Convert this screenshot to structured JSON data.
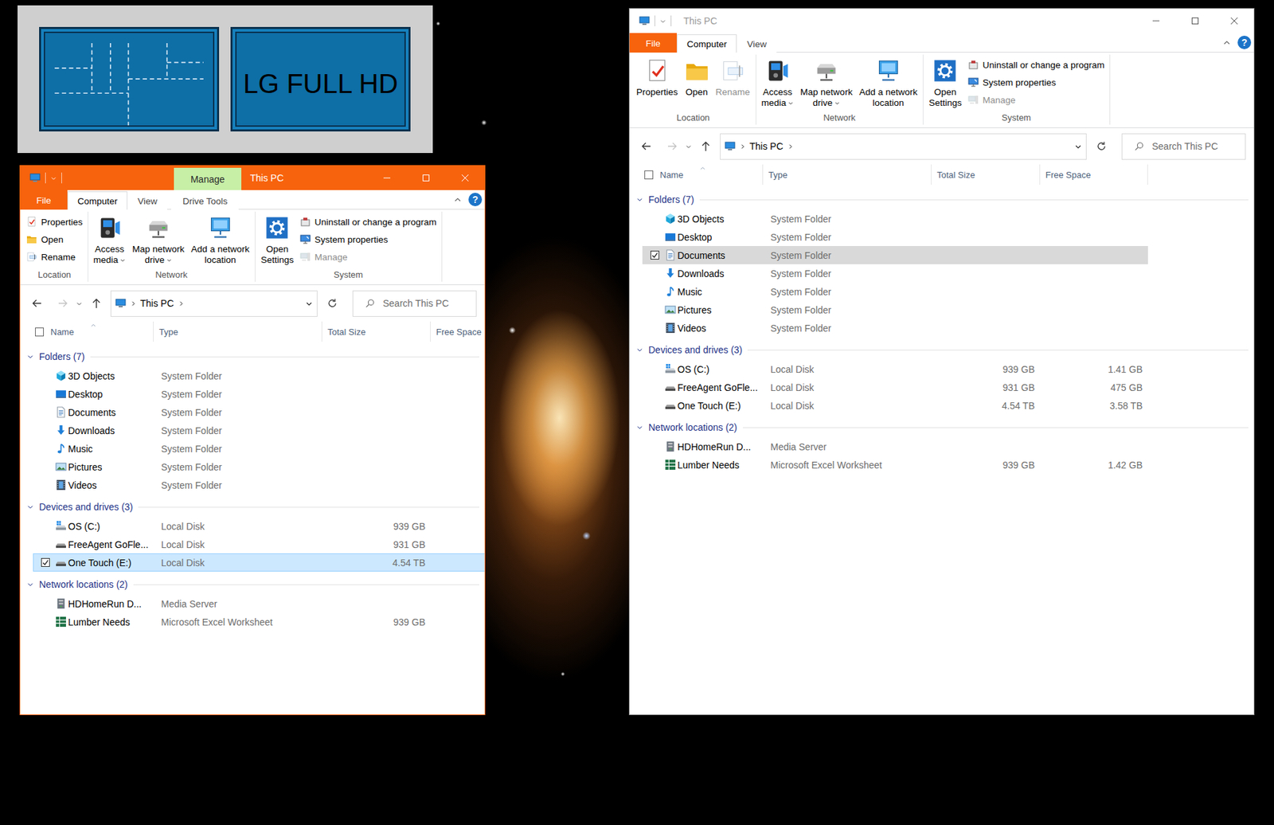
{
  "display_identify": {
    "monitors": [
      {
        "kind": "zones"
      },
      {
        "kind": "label",
        "label": "LG FULL HD"
      }
    ]
  },
  "windows": [
    {
      "title": "This PC",
      "active": true,
      "contextual_tab": "Manage",
      "help": "?",
      "ribbon_tabs": [
        {
          "label": "File",
          "selected": false,
          "kind": "file"
        },
        {
          "label": "Computer",
          "selected": true,
          "kind": "tab"
        },
        {
          "label": "View",
          "selected": false,
          "kind": "tab"
        },
        {
          "label": "Drive Tools",
          "selected": false,
          "kind": "contextual"
        }
      ],
      "ribbon_groups": [
        {
          "label": "Location",
          "buttons": [
            {
              "lines": [
                "Properties"
              ],
              "kind": "small",
              "dropdown": false,
              "disabled": false
            },
            {
              "lines": [
                "Open"
              ],
              "kind": "small",
              "dropdown": false,
              "disabled": false
            },
            {
              "lines": [
                "Rename"
              ],
              "kind": "small",
              "dropdown": false,
              "disabled": false
            }
          ]
        },
        {
          "label": "Network",
          "buttons": [
            {
              "lines": [
                "Access",
                "media"
              ],
              "kind": "large",
              "dropdown": true,
              "disabled": false
            },
            {
              "lines": [
                "Map network",
                "drive"
              ],
              "kind": "large",
              "dropdown": true,
              "disabled": false
            },
            {
              "lines": [
                "Add a network",
                "location"
              ],
              "kind": "large",
              "dropdown": false,
              "disabled": false
            }
          ]
        },
        {
          "label": "System",
          "buttons": [
            {
              "lines": [
                "Open",
                "Settings"
              ],
              "kind": "large",
              "dropdown": false,
              "disabled": false
            },
            {
              "lines": [
                "Uninstall or change a program"
              ],
              "kind": "small",
              "dropdown": false,
              "disabled": false
            },
            {
              "lines": [
                "System properties"
              ],
              "kind": "small",
              "dropdown": false,
              "disabled": false
            },
            {
              "lines": [
                "Manage"
              ],
              "kind": "small",
              "dropdown": false,
              "disabled": true
            }
          ]
        }
      ],
      "navigation": {
        "back_disabled": false,
        "forward_disabled": true
      },
      "address": {
        "location": "This PC"
      },
      "search": {
        "placeholder": "Search This PC"
      },
      "columns": [
        {
          "label": "Name",
          "sorted": true
        },
        {
          "label": "Type",
          "sorted": false
        },
        {
          "label": "Total Size",
          "sorted": false
        },
        {
          "label": "Free Space",
          "sorted": false
        }
      ],
      "sections": [
        {
          "label": "Folders (7)",
          "expanded": true,
          "rows": [
            {
              "name": "3D Objects",
              "type": "System Folder",
              "selected": false,
              "checked": false
            },
            {
              "name": "Desktop",
              "type": "System Folder",
              "selected": false,
              "checked": false
            },
            {
              "name": "Documents",
              "type": "System Folder",
              "selected": false,
              "checked": false
            },
            {
              "name": "Downloads",
              "type": "System Folder",
              "selected": false,
              "checked": false
            },
            {
              "name": "Music",
              "type": "System Folder",
              "selected": false,
              "checked": false
            },
            {
              "name": "Pictures",
              "type": "System Folder",
              "selected": false,
              "checked": false
            },
            {
              "name": "Videos",
              "type": "System Folder",
              "selected": false,
              "checked": false
            }
          ]
        },
        {
          "label": "Devices and drives (3)",
          "expanded": true,
          "rows": [
            {
              "name": "OS (C:)",
              "type": "Local Disk",
              "total": "939 GB",
              "selected": false,
              "checked": false
            },
            {
              "name": "FreeAgent GoFle...",
              "type": "Local Disk",
              "total": "931 GB",
              "selected": false,
              "checked": false
            },
            {
              "name": "One Touch (E:)",
              "type": "Local Disk",
              "total": "4.54 TB",
              "selected": true,
              "checked": true
            }
          ]
        },
        {
          "label": "Network locations (2)",
          "expanded": true,
          "rows": [
            {
              "name": "HDHomeRun D...",
              "type": "Media Server",
              "selected": false,
              "checked": false
            },
            {
              "name": "Lumber Needs",
              "type": "Microsoft Excel Worksheet",
              "total": "939 GB",
              "selected": false,
              "checked": false
            }
          ]
        }
      ]
    },
    {
      "title": "This PC",
      "active": false,
      "help": "?",
      "ribbon_tabs": [
        {
          "label": "File",
          "selected": false,
          "kind": "file"
        },
        {
          "label": "Computer",
          "selected": true,
          "kind": "tab"
        },
        {
          "label": "View",
          "selected": false,
          "kind": "tab"
        }
      ],
      "ribbon_groups": [
        {
          "label": "Location",
          "buttons": [
            {
              "lines": [
                "Properties"
              ],
              "kind": "large",
              "dropdown": false,
              "disabled": false
            },
            {
              "lines": [
                "Open"
              ],
              "kind": "large",
              "dropdown": false,
              "disabled": false
            },
            {
              "lines": [
                "Rename"
              ],
              "kind": "large",
              "dropdown": false,
              "disabled": true
            }
          ]
        },
        {
          "label": "Network",
          "buttons": [
            {
              "lines": [
                "Access",
                "media"
              ],
              "kind": "large",
              "dropdown": true,
              "disabled": false
            },
            {
              "lines": [
                "Map network",
                "drive"
              ],
              "kind": "large",
              "dropdown": true,
              "disabled": false
            },
            {
              "lines": [
                "Add a network",
                "location"
              ],
              "kind": "large",
              "dropdown": false,
              "disabled": false
            }
          ]
        },
        {
          "label": "System",
          "buttons": [
            {
              "lines": [
                "Open",
                "Settings"
              ],
              "kind": "large",
              "dropdown": false,
              "disabled": false
            },
            {
              "lines": [
                "Uninstall or change a program"
              ],
              "kind": "small",
              "dropdown": false,
              "disabled": false
            },
            {
              "lines": [
                "System properties"
              ],
              "kind": "small",
              "dropdown": false,
              "disabled": false
            },
            {
              "lines": [
                "Manage"
              ],
              "kind": "small",
              "dropdown": false,
              "disabled": true
            }
          ]
        }
      ],
      "navigation": {
        "back_disabled": false,
        "forward_disabled": true
      },
      "address": {
        "location": "This PC"
      },
      "search": {
        "placeholder": "Search This PC"
      },
      "columns": [
        {
          "label": "Name",
          "sorted": true
        },
        {
          "label": "Type",
          "sorted": false
        },
        {
          "label": "Total Size",
          "sorted": false
        },
        {
          "label": "Free Space",
          "sorted": false
        }
      ],
      "sections": [
        {
          "label": "Folders (7)",
          "expanded": true,
          "rows": [
            {
              "name": "3D Objects",
              "type": "System Folder",
              "selected": false,
              "checked": false
            },
            {
              "name": "Desktop",
              "type": "System Folder",
              "selected": false,
              "checked": false
            },
            {
              "name": "Documents",
              "type": "System Folder",
              "selected": true,
              "checked": true
            },
            {
              "name": "Downloads",
              "type": "System Folder",
              "selected": false,
              "checked": false
            },
            {
              "name": "Music",
              "type": "System Folder",
              "selected": false,
              "checked": false
            },
            {
              "name": "Pictures",
              "type": "System Folder",
              "selected": false,
              "checked": false
            },
            {
              "name": "Videos",
              "type": "System Folder",
              "selected": false,
              "checked": false
            }
          ]
        },
        {
          "label": "Devices and drives (3)",
          "expanded": true,
          "rows": [
            {
              "name": "OS (C:)",
              "type": "Local Disk",
              "total": "939 GB",
              "free": "1.41 GB",
              "selected": false,
              "checked": false
            },
            {
              "name": "FreeAgent GoFle...",
              "type": "Local Disk",
              "total": "931 GB",
              "free": "475 GB",
              "selected": false,
              "checked": false
            },
            {
              "name": "One Touch (E:)",
              "type": "Local Disk",
              "total": "4.54 TB",
              "free": "3.58 TB",
              "selected": false,
              "checked": false
            }
          ]
        },
        {
          "label": "Network locations (2)",
          "expanded": true,
          "rows": [
            {
              "name": "HDHomeRun D...",
              "type": "Media Server",
              "selected": false,
              "checked": false
            },
            {
              "name": "Lumber Needs",
              "type": "Microsoft Excel Worksheet",
              "total": "939 GB",
              "free": "1.42 GB",
              "selected": false,
              "checked": false
            }
          ]
        }
      ]
    }
  ]
}
